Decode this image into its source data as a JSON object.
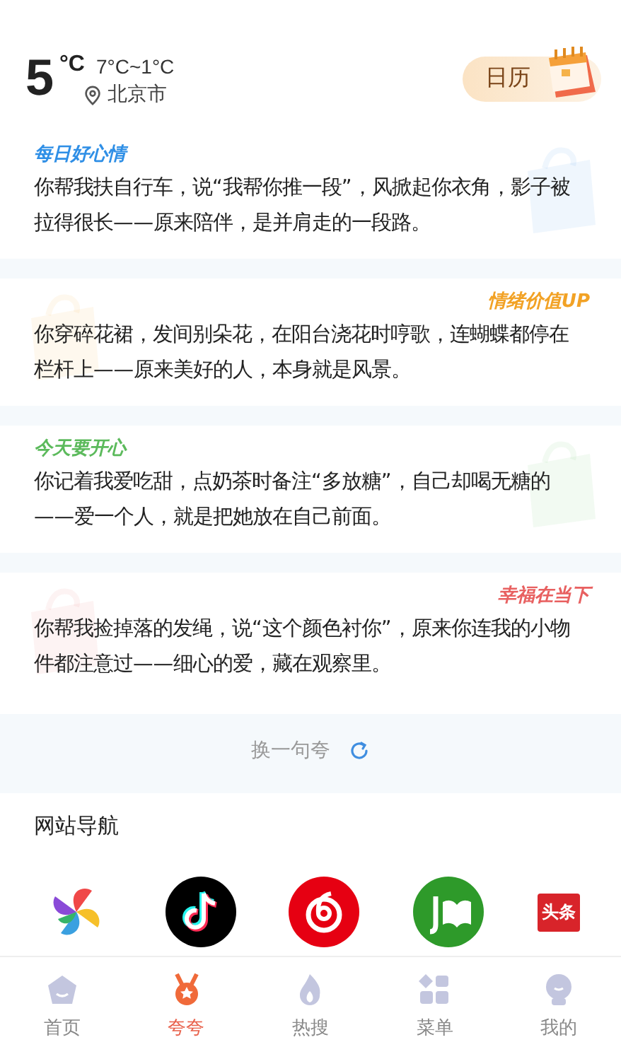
{
  "weather": {
    "temperature": "5",
    "unit": "°C",
    "range": "7°C~1°C",
    "city": "北京市"
  },
  "calendar_button": {
    "label": "日历"
  },
  "quotes": [
    {
      "tag": "每日好心情",
      "color": "#2f8fe6",
      "text": "你帮我扶自行车，说“我帮你推一段”，风掀起你衣角，影子被拉得很长——原来陪伴，是并肩走的一段路。"
    },
    {
      "tag": "情绪价值UP",
      "color": "#f2a225",
      "text": "你穿碎花裙，发间别朵花，在阳台浇花时哼歌，连蝴蝶都停在栏杆上——原来美好的人，本身就是风景。"
    },
    {
      "tag": "今天要开心",
      "color": "#5cba5c",
      "text": "你记着我爱吃甜，点奶茶时备注“多放糖”，自己却喝无糖的——爱一个人，就是把她放在自己前面。"
    },
    {
      "tag": "幸福在当下",
      "color": "#e86060",
      "text": "你帮我捡掉落的发绳，说“这个颜色衬你”，原来你连我的小物件都注意过——细心的爱，藏在观察里。"
    }
  ],
  "refresh_button": {
    "label": "换一句夸"
  },
  "site_nav": {
    "title": "网站导航",
    "sites": [
      {
        "kind": "pinwheel"
      },
      {
        "kind": "note"
      },
      {
        "kind": "music"
      },
      {
        "kind": "book"
      },
      {
        "kind": "badge",
        "label": "头条"
      }
    ]
  },
  "tab_bar": [
    {
      "label": "首页",
      "selected": false
    },
    {
      "label": "夸夸",
      "selected": true
    },
    {
      "label": "热搜",
      "selected": false
    },
    {
      "label": "菜单",
      "selected": false
    },
    {
      "label": "我的",
      "selected": false
    }
  ]
}
